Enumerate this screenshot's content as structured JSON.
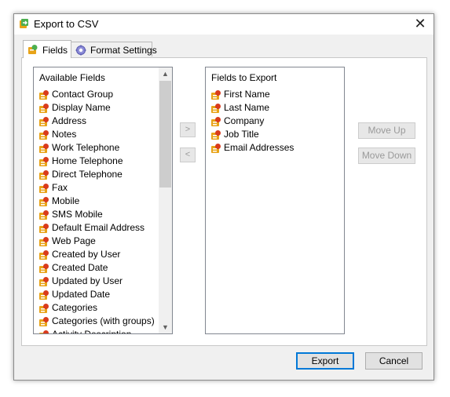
{
  "window": {
    "title": "Export to CSV",
    "close_glyph": "✕",
    "icon": "export-csv-icon"
  },
  "tabs": [
    {
      "label": "Fields",
      "icon": "fields-tab-icon",
      "active": true
    },
    {
      "label": "Format Settings",
      "icon": "gear-icon",
      "active": false
    }
  ],
  "available_fields": {
    "header": "Available Fields",
    "items": [
      "Contact Group",
      "Display Name",
      "Address",
      "Notes",
      "Work Telephone",
      "Home Telephone",
      "Direct Telephone",
      "Fax",
      "Mobile",
      "SMS Mobile",
      "Default Email Address",
      "Web Page",
      "Created by User",
      "Created Date",
      "Updated by User",
      "Updated Date",
      "Categories",
      "Categories (with groups)",
      "Activity Description"
    ],
    "scroll_up": "▲",
    "scroll_down": "▼"
  },
  "fields_to_export": {
    "header": "Fields to Export",
    "items": [
      "First Name",
      "Last Name",
      "Company",
      "Job Title",
      "Email Addresses"
    ]
  },
  "controls": {
    "add_label": ">",
    "remove_label": "<",
    "move_up_label": "Move Up",
    "move_down_label": "Move Down"
  },
  "footer": {
    "export_label": "Export",
    "cancel_label": "Cancel"
  },
  "colors": {
    "accent": "#0078d7",
    "icon_body": "#e8a317",
    "icon_accent": "#d93b1c",
    "icon_leaf": "#4caf50"
  }
}
